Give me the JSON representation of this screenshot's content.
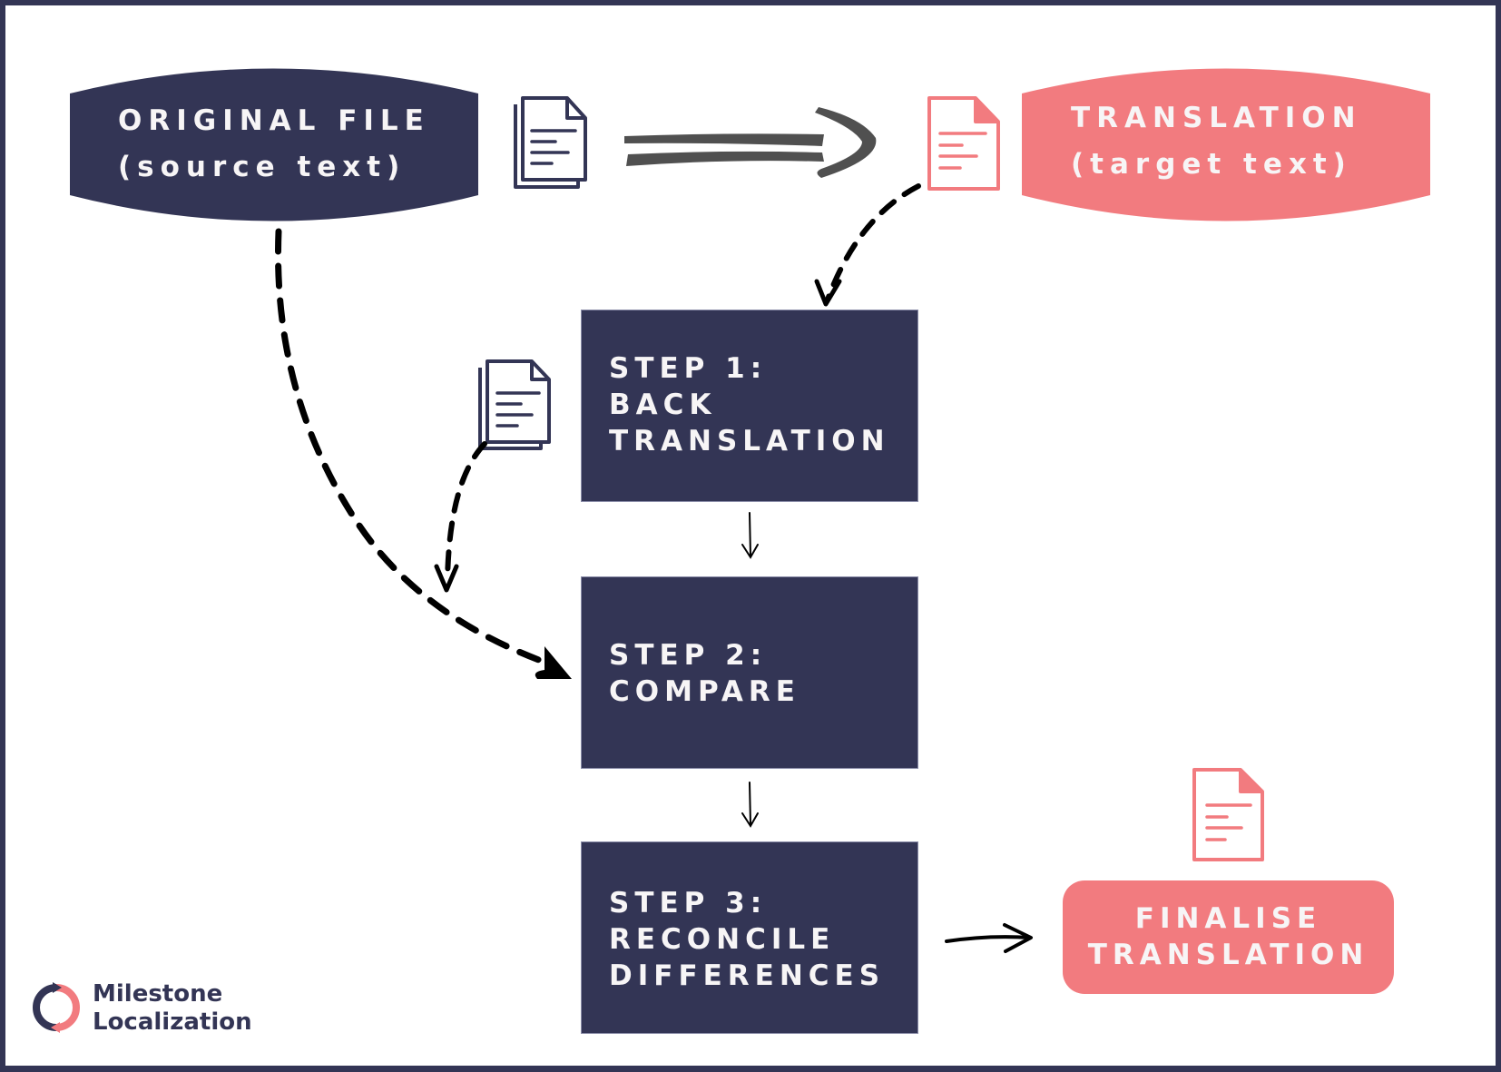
{
  "colors": {
    "navy": "#333555",
    "coral": "#f27b7f",
    "text_light": "#f7f5f6",
    "arrow_gray": "#505050",
    "arrow_black": "#000000"
  },
  "nodes": {
    "original_file": {
      "line1": "ORIGINAL FILE",
      "line2": "(source text)",
      "icon": "documents-icon"
    },
    "translation": {
      "line1": "TRANSLATION",
      "line2": "(target text)",
      "icon": "document-icon"
    },
    "step1": {
      "line1": "STEP 1:",
      "line2": "BACK",
      "line3": "TRANSLATION"
    },
    "step2": {
      "line1": "STEP 2:",
      "line2": "COMPARE"
    },
    "step3": {
      "line1": "STEP 3:",
      "line2": "RECONCILE",
      "line3": "DIFFERENCES"
    },
    "finalise": {
      "line1": "FINALISE",
      "line2": "TRANSLATION",
      "icon": "document-icon"
    }
  },
  "edges": [
    {
      "from": "original_file",
      "to": "translation",
      "style": "thick-brush"
    },
    {
      "from": "translation",
      "to": "step1",
      "style": "dashed"
    },
    {
      "from": "original_file",
      "to": "step2",
      "style": "dashed"
    },
    {
      "from": "back_translation_document",
      "to": "step2",
      "style": "dashed"
    },
    {
      "from": "step1",
      "to": "step2",
      "style": "thin"
    },
    {
      "from": "step2",
      "to": "step3",
      "style": "thin"
    },
    {
      "from": "step3",
      "to": "finalise",
      "style": "sketch"
    }
  ],
  "logo": {
    "line1": "Milestone",
    "line2": "Localization"
  }
}
